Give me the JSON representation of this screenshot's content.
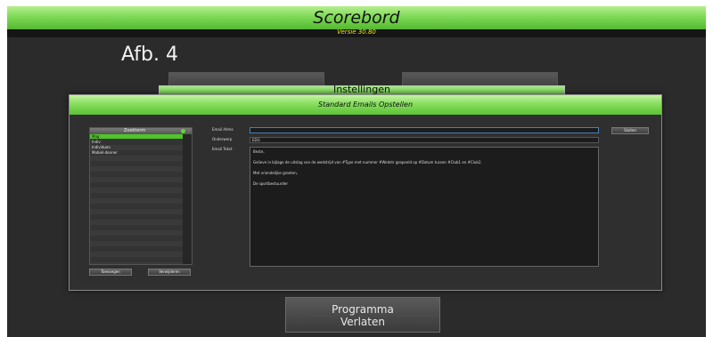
{
  "app": {
    "title": "Scorebord",
    "version": "Versie 30.80"
  },
  "page": {
    "heading": "Afb. 4",
    "background_panel_title": "Instellingen"
  },
  "exit_button": {
    "line1": "Programma",
    "line2": "Verlaten"
  },
  "dialog": {
    "title": "Standard Emails Opstellen",
    "list": {
      "header": "Zoekterm",
      "items": [
        "Mag",
        "Indiv",
        "Individuen",
        "Mobiel-donner"
      ],
      "selected_index": 0
    },
    "buttons": {
      "add": "Toevoegen",
      "delete": "Verwijderen",
      "close": "Sluiten"
    },
    "fields": {
      "email_label": "Email Adres",
      "email_value": "",
      "subject_label": "Onderwerp",
      "subject_value": "EDG",
      "body_label": "Email Tekst",
      "body_lines": [
        "Beste,",
        "",
        "Gelieve in bijlage de uitslag van de wedstrijd van #Type met nummer #Wedstr gespeeld op #Datum tussen #Club1 en #Club2.",
        "",
        "Met vriendelijke groeten,",
        "",
        "De sportbestuurder"
      ]
    }
  },
  "colors": {
    "accent_green": "#62c23c",
    "version_yellow": "#f2e400",
    "background": "#2b2b2b"
  }
}
